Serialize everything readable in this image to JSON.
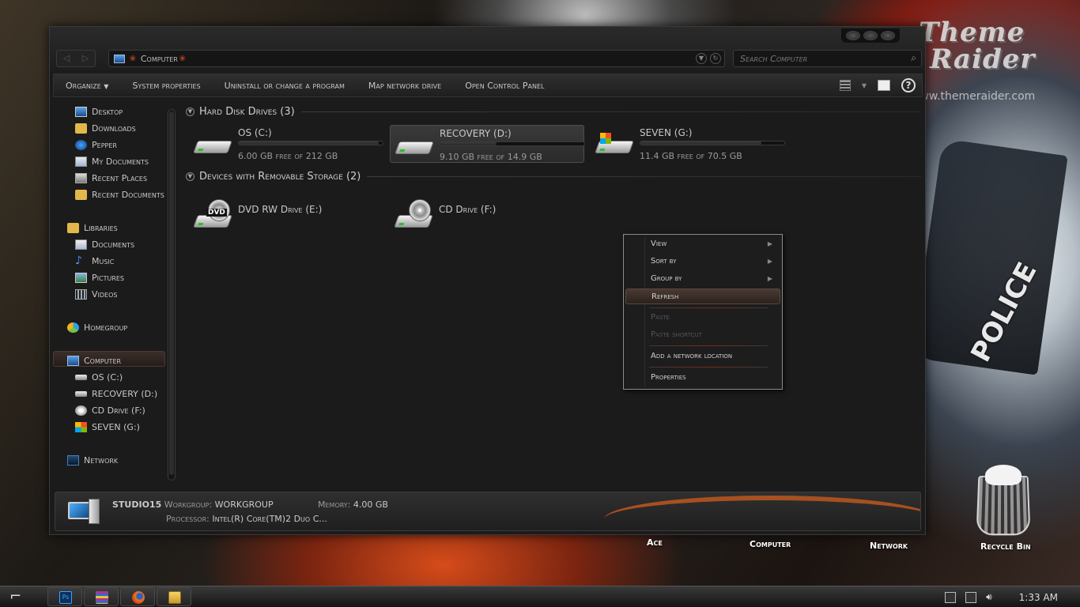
{
  "watermark": {
    "line1": "Theme",
    "line2": "Raider",
    "url": "www.themeraider.com"
  },
  "background": {
    "police_text": "POLICE"
  },
  "window": {
    "address": {
      "path": "Computer"
    },
    "search": {
      "placeholder": "Search Computer"
    },
    "nav": {
      "back": "◁",
      "forward": "▷"
    },
    "toolbar": {
      "organize": "Organize",
      "system_properties": "System properties",
      "uninstall": "Uninstall or change a program",
      "map_drive": "Map network drive",
      "control_panel": "Open Control Panel",
      "help": "?"
    },
    "sidebar": {
      "favorites": [
        "Desktop",
        "Downloads",
        "Pepper",
        "My Documents",
        "Recent Places",
        "Recent Documents"
      ],
      "libraries": {
        "label": "Libraries",
        "items": [
          "Documents",
          "Music",
          "Pictures",
          "Videos"
        ]
      },
      "homegroup": "Homegroup",
      "computer": {
        "label": "Computer",
        "items": [
          "OS (C:)",
          "RECOVERY (D:)",
          "CD Drive (F:)",
          "SEVEN (G:)"
        ]
      },
      "network": "Network"
    },
    "groups": {
      "hdd": "Hard Disk Drives (3)",
      "removable": "Devices with Removable Storage (2)"
    },
    "drives": [
      {
        "name": "OS (C:)",
        "free": "6.00 GB free of 212 GB",
        "used_fraction": 0.97
      },
      {
        "name": "RECOVERY (D:)",
        "free": "9.10 GB free of 14.9 GB",
        "used_fraction": 0.39
      },
      {
        "name": "SEVEN (G:)",
        "free": "11.4 GB free of 70.5 GB",
        "used_fraction": 0.84
      }
    ],
    "removable": [
      {
        "name": "DVD RW Drive (E:)",
        "badge": "DVD"
      },
      {
        "name": "CD Drive (F:)"
      }
    ],
    "context_menu": {
      "view": "View",
      "sort_by": "Sort by",
      "group_by": "Group by",
      "refresh": "Refresh",
      "paste": "Paste",
      "paste_shortcut": "Paste shortcut",
      "add_network_location": "Add a network location",
      "properties": "Properties"
    },
    "details": {
      "computer_name": "STUDIO15",
      "workgroup_label": "Workgroup:",
      "workgroup": "WORKGROUP",
      "memory_label": "Memory:",
      "memory": "4.00 GB",
      "processor_label": "Processor:",
      "processor": "Intel(R) Core(TM)2 Duo C..."
    }
  },
  "desktop": {
    "icons": [
      "Ace",
      "Computer",
      "Network",
      "Recycle Bin"
    ]
  },
  "taskbar": {
    "clock": "1:33 AM",
    "apps": [
      "photoshop-icon",
      "winrar-icon",
      "firefox-icon",
      "explorer-icon"
    ],
    "ps": "Ps"
  }
}
